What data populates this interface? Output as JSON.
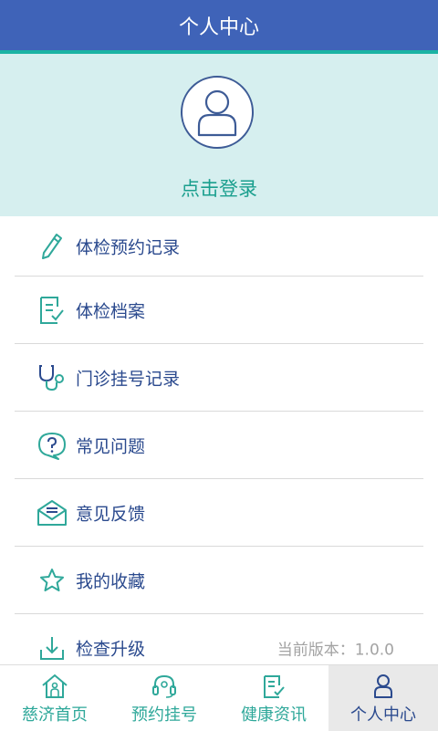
{
  "header": {
    "title": "个人中心"
  },
  "profile": {
    "login_label": "点击登录"
  },
  "menu": {
    "items": [
      {
        "label": "体检预约记录",
        "icon": "pencil-icon"
      },
      {
        "label": "体检档案",
        "icon": "document-check-icon"
      },
      {
        "label": "门诊挂号记录",
        "icon": "stethoscope-icon"
      },
      {
        "label": "常见问题",
        "icon": "question-bubble-icon"
      },
      {
        "label": "意见反馈",
        "icon": "envelope-icon"
      },
      {
        "label": "我的收藏",
        "icon": "star-icon"
      },
      {
        "label": "检查升级",
        "icon": "download-icon",
        "version": "当前版本：1.0.0"
      }
    ]
  },
  "tabbar": {
    "tabs": [
      {
        "label": "慈济首页",
        "icon": "home-icon"
      },
      {
        "label": "预约挂号",
        "icon": "headset-icon"
      },
      {
        "label": "健康资讯",
        "icon": "news-icon"
      },
      {
        "label": "个人中心",
        "icon": "user-icon",
        "active": true
      }
    ]
  },
  "colors": {
    "header": "#3f63b8",
    "accent_teal": "#1bb3a3",
    "profile_bg": "#d6efef",
    "menu_text": "#2b4a8e",
    "icon_teal": "#2fa89a"
  }
}
